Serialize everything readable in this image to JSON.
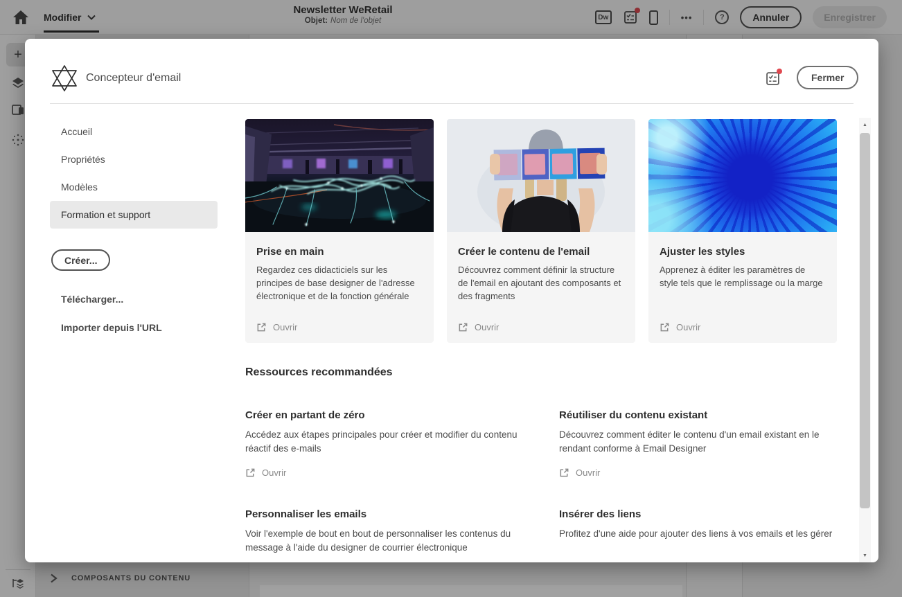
{
  "topbar": {
    "mode_tab": "Modifier",
    "doc_title": "Newsletter WeRetail",
    "subject_label": "Objet:",
    "subject_value": "Nom de l'objet",
    "dw_icon_label": "Dw",
    "more_icon": "•••",
    "help_icon": "?",
    "cancel_button": "Annuler",
    "save_button": "Enregistrer"
  },
  "rail": {
    "plus_icon": "+"
  },
  "bottom_panel": {
    "title": "COMPOSANTS DU CONTENU"
  },
  "scrollbar": {
    "up_icon": "▲",
    "down_icon": "▼"
  },
  "dialog": {
    "title": "Concepteur d'email",
    "close_button": "Fermer",
    "nav_items": [
      {
        "label": "Accueil",
        "selected": false
      },
      {
        "label": "Propriétés",
        "selected": false
      },
      {
        "label": "Modèles",
        "selected": false
      },
      {
        "label": "Formation et support",
        "selected": true
      }
    ],
    "create_button": "Créer...",
    "download_link": "Télécharger...",
    "import_link": "Importer depuis l'URL",
    "cards": [
      {
        "title": "Prise en main",
        "description": "Regardez ces didacticiels sur les principes de base designer de l'adresse électronique et de la fonction générale",
        "action": "Ouvrir"
      },
      {
        "title": "Créer le contenu de l'email",
        "description": "Découvrez comment définir la structure de l'email en ajoutant des composants et des fragments",
        "action": "Ouvrir"
      },
      {
        "title": "Ajuster les styles",
        "description": "Apprenez à éditer les paramètres de style tels que le remplissage ou la marge",
        "action": "Ouvrir"
      }
    ],
    "resources_heading": "Ressources recommandées",
    "resources": [
      {
        "title": "Créer en partant de zéro",
        "description": "Accédez aux étapes principales pour créer et modifier du contenu réactif des e-mails",
        "action": "Ouvrir"
      },
      {
        "title": "Réutiliser du contenu existant",
        "description": "Découvrez comment éditer le contenu d'un email existant en le rendant conforme à Email Designer",
        "action": "Ouvrir"
      },
      {
        "title": "Personnaliser les emails",
        "description": "Voir l'exemple de bout en bout de personnaliser les contenus du message à l'aide du designer de courrier électronique"
      },
      {
        "title": "Insérer des liens",
        "description": "Profitez d'une aide pour ajouter des liens à vos emails et les gérer"
      }
    ]
  },
  "colors": {
    "badge_red": "#e0484f",
    "selected_nav_bg": "#e9e9e9",
    "card_bg": "#f5f5f5"
  }
}
